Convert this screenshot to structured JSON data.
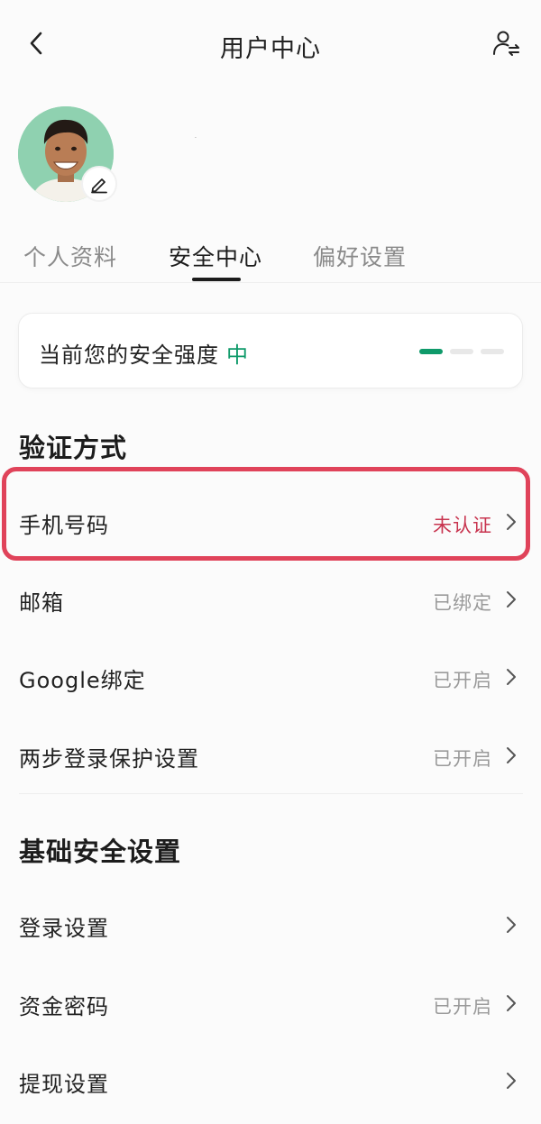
{
  "header": {
    "title": "用户中心",
    "back_icon": "chevron-left-icon",
    "switch_user_icon": "user-switch-icon"
  },
  "profile": {
    "username": "·",
    "edit_icon": "pencil-icon"
  },
  "tabs": [
    {
      "label": "个人资料",
      "active": false
    },
    {
      "label": "安全中心",
      "active": true
    },
    {
      "label": "偏好设置",
      "active": false
    }
  ],
  "security_strength": {
    "label": "当前您的安全强度",
    "level": "中",
    "level_color": "#0f9a6a",
    "segments_filled": 1,
    "segments_total": 3
  },
  "verification": {
    "title": "验证方式",
    "items": [
      {
        "label": "手机号码",
        "status": "未认证",
        "highlighted": true
      },
      {
        "label": "邮箱",
        "status": "已绑定"
      },
      {
        "label": "Google绑定",
        "status": "已开启"
      },
      {
        "label": "两步登录保护设置",
        "status": "已开启"
      }
    ]
  },
  "basic_security": {
    "title": "基础安全设置",
    "items": [
      {
        "label": "登录设置",
        "status": ""
      },
      {
        "label": "资金密码",
        "status": "已开启"
      },
      {
        "label": "提现设置",
        "status": ""
      }
    ]
  },
  "colors": {
    "accent_green": "#0f9a6a",
    "warning_red": "#c8344f",
    "highlight_border": "#e0435a"
  }
}
